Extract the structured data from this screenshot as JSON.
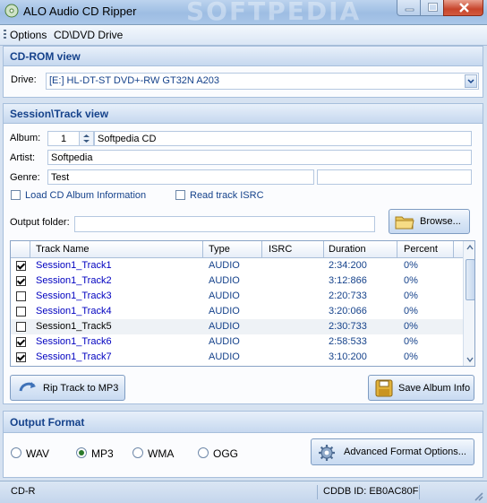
{
  "window": {
    "title": "ALO Audio CD Ripper",
    "watermark": "SOFTPEDIA"
  },
  "menu": {
    "items": [
      "Options",
      "CD\\DVD Drive"
    ]
  },
  "cdrom": {
    "title": "CD-ROM view",
    "drive_label": "Drive:",
    "drive_value": "[E:]  HL-DT-ST  DVD+-RW GT32N     A203"
  },
  "session": {
    "title": "Session\\Track view",
    "album_label": "Album:",
    "album_number": "1",
    "album_value": "Softpedia CD",
    "artist_label": "Artist:",
    "artist_value": "Softpedia",
    "genre_label": "Genre:",
    "genre_value": "Test",
    "load_info_label": "Load CD Album Information",
    "read_isrc_label": "Read track ISRC",
    "output_folder_label": "Output folder:",
    "output_folder_value": "",
    "browse_label": "Browse..."
  },
  "grid": {
    "columns": [
      "Track Name",
      "Type",
      "ISRC",
      "Duration",
      "Percent"
    ],
    "rows": [
      {
        "checked": true,
        "name": "Session1_Track1",
        "type": "AUDIO",
        "isrc": "",
        "duration": "2:34:200",
        "percent": "0%"
      },
      {
        "checked": true,
        "name": "Session1_Track2",
        "type": "AUDIO",
        "isrc": "",
        "duration": "3:12:866",
        "percent": "0%"
      },
      {
        "checked": false,
        "name": "Session1_Track3",
        "type": "AUDIO",
        "isrc": "",
        "duration": "2:20:733",
        "percent": "0%"
      },
      {
        "checked": false,
        "name": "Session1_Track4",
        "type": "AUDIO",
        "isrc": "",
        "duration": "3:20:066",
        "percent": "0%"
      },
      {
        "checked": false,
        "name": "Session1_Track5",
        "type": "AUDIO",
        "isrc": "",
        "duration": "2:30:733",
        "percent": "0%"
      },
      {
        "checked": true,
        "name": "Session1_Track6",
        "type": "AUDIO",
        "isrc": "",
        "duration": "2:58:533",
        "percent": "0%"
      },
      {
        "checked": true,
        "name": "Session1_Track7",
        "type": "AUDIO",
        "isrc": "",
        "duration": "3:10:200",
        "percent": "0%"
      }
    ]
  },
  "actions": {
    "rip_label": "Rip Track to MP3",
    "save_label": "Save Album Info"
  },
  "output": {
    "title": "Output Format",
    "formats": [
      "WAV",
      "MP3",
      "WMA",
      "OGG"
    ],
    "selected": "MP3",
    "advanced_label": "Advanced Format Options..."
  },
  "status": {
    "left": "CD-R",
    "cddb": "CDDB ID: EB0AC80F"
  },
  "colors": {
    "header_text": "#15428b",
    "track_selected_text": "#0000c0",
    "selected_row": "#eef2f6"
  }
}
